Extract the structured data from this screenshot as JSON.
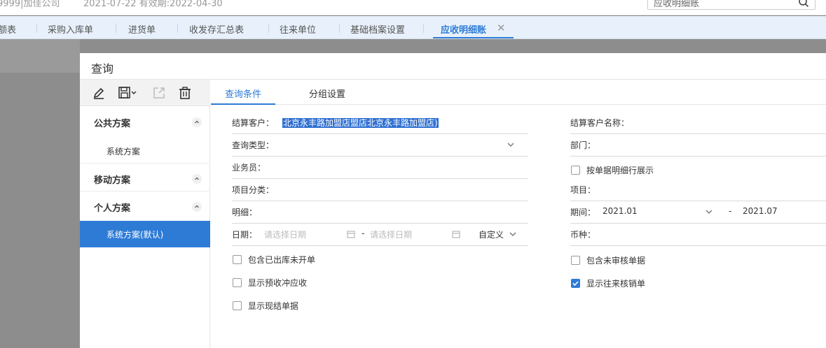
{
  "header": {
    "company": "9999|加佳公司",
    "dates": "2021-07-22    有效期:2022-04-30",
    "search_value": "应收明细账"
  },
  "tabs": [
    {
      "label": "额表"
    },
    {
      "label": "采购入库单"
    },
    {
      "label": "进货单"
    },
    {
      "label": "收发存汇总表"
    },
    {
      "label": "往来单位"
    },
    {
      "label": "基础档案设置"
    },
    {
      "label": "应收明细账",
      "active": true
    }
  ],
  "dialog": {
    "title": "查询",
    "groups": [
      {
        "name": "公共方案",
        "items": [
          "系统方案"
        ]
      },
      {
        "name": "移动方案",
        "items": []
      },
      {
        "name": "个人方案",
        "items": [
          "系统方案(默认)"
        ]
      }
    ],
    "right_tabs": [
      "查询条件",
      "分组设置"
    ],
    "fields": {
      "customer_label": "结算客户：",
      "customer_value": "北京永丰路加盟店盟店北京永丰路加盟店)",
      "query_type_label": "查询类型：",
      "salesman_label": "业务员：",
      "project_category_label": "项目分类：",
      "detail_label": "明细：",
      "date_label": "日期：",
      "date_start_placeholder": "请选择日期",
      "date_sep": "-",
      "date_end_placeholder": "请选择日期",
      "date_mode": "自定义",
      "customer_name_label": "结算客户名称：",
      "department_label": "部门：",
      "project_label": "项目：",
      "period_label": "期间：",
      "period_start": "2021.01",
      "period_sep": "-",
      "period_end": "2021.07",
      "currency_label": "币种："
    },
    "checkboxes": {
      "bill_detail": {
        "label": "按单据明细行展示",
        "checked": false
      },
      "include_out_stock": {
        "label": "包含已出库未开单",
        "checked": false
      },
      "show_prepay": {
        "label": "显示预收冲应收",
        "checked": false
      },
      "show_cash": {
        "label": "显示现结单据",
        "checked": false
      },
      "include_unaudited": {
        "label": "包含未审核单据",
        "checked": false
      },
      "show_writeoff": {
        "label": "显示往来核销单",
        "checked": true
      }
    }
  },
  "colors": {
    "accent": "#2e7bd6",
    "selection": "#2e6fd1"
  }
}
